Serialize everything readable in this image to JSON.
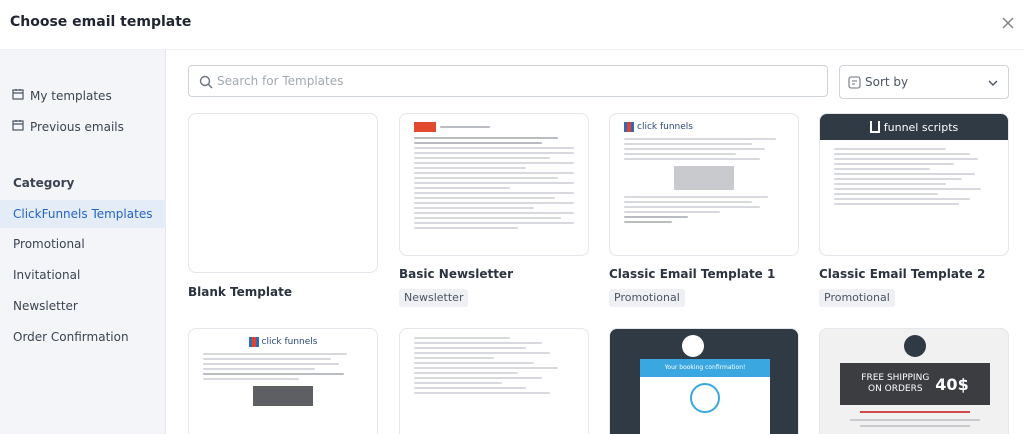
{
  "dialog": {
    "title": "Choose email template"
  },
  "sidebar": {
    "links": [
      {
        "label": "My templates"
      },
      {
        "label": "Previous emails"
      }
    ],
    "category_title": "Category",
    "categories": [
      {
        "label": "ClickFunnels Templates",
        "active": true
      },
      {
        "label": "Promotional"
      },
      {
        "label": "Invitational"
      },
      {
        "label": "Newsletter"
      },
      {
        "label": "Order Confirmation"
      }
    ]
  },
  "toolbar": {
    "search_placeholder": "Search for Templates",
    "sort_label": "Sort by"
  },
  "templates": [
    {
      "name": "Blank Template",
      "tag": ""
    },
    {
      "name": "Basic Newsletter",
      "tag": "Newsletter"
    },
    {
      "name": "Classic Email Template 1",
      "tag": "Promotional"
    },
    {
      "name": "Classic Email Template 2",
      "tag": "Promotional"
    }
  ],
  "thumbs": {
    "funnel_scripts_logo": "funnel scripts",
    "clickfunnels_logo": "click funnels",
    "free_shipping_line1": "FREE SHIPPING",
    "free_shipping_line2": "ON ORDERS",
    "free_shipping_amount": "40$",
    "booking_headline": "Your booking confirmation!"
  },
  "colors": {
    "accent": "#2563c9",
    "active_bg": "#e4ecf8",
    "sidebar_bg": "#f4f5f8",
    "dark_header": "#2f3a44",
    "sky_blue": "#3aa7e0"
  }
}
